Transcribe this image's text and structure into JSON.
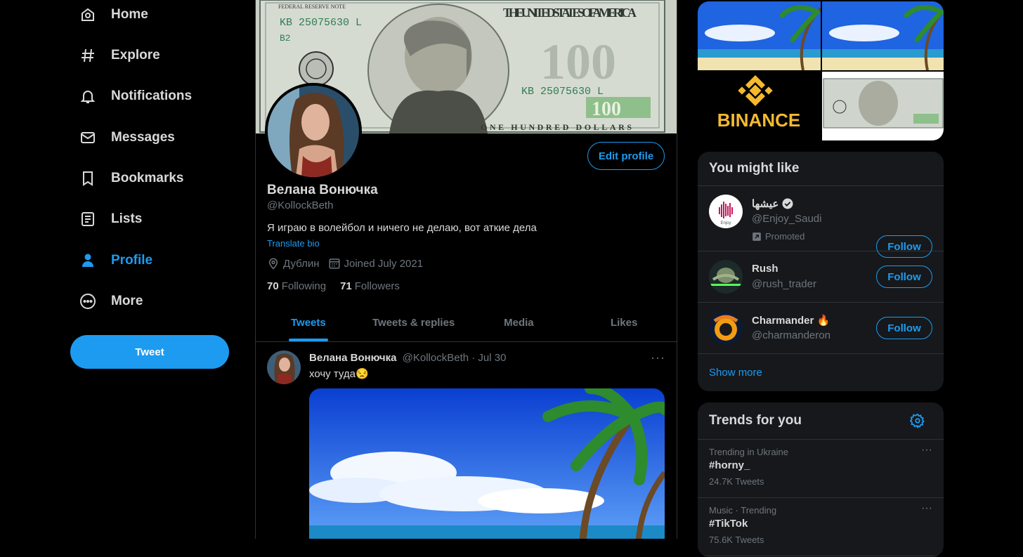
{
  "nav": {
    "items": [
      {
        "label": "Home",
        "icon": "home-icon"
      },
      {
        "label": "Explore",
        "icon": "hashtag-icon"
      },
      {
        "label": "Notifications",
        "icon": "bell-icon"
      },
      {
        "label": "Messages",
        "icon": "envelope-icon"
      },
      {
        "label": "Bookmarks",
        "icon": "bookmark-icon"
      },
      {
        "label": "Lists",
        "icon": "list-icon"
      },
      {
        "label": "Profile",
        "icon": "person-icon",
        "active": true
      },
      {
        "label": "More",
        "icon": "more-circle-icon"
      }
    ],
    "tweet_button": "Tweet"
  },
  "profile": {
    "name": "Велана Вонючка",
    "handle": "@KollockBeth",
    "bio": "Я играю в волейбол и ничего не делаю, вот аткие дела",
    "translate": "Translate bio",
    "location": "Дублин",
    "joined": "Joined July 2021",
    "following_count": "70",
    "following_label": "Following",
    "followers_count": "71",
    "followers_label": "Followers",
    "edit_button": "Edit profile",
    "banner": {
      "text_top": "FEDERAL RESERVE NOTE",
      "serial_1": "KB 25075630 L",
      "serial_2": "B2",
      "usa": "THE UNITED STATES OF AMERICA",
      "number": "100",
      "serial_3": "KB 25075630 L",
      "bottom": "ONE HUNDRED DOLLARS"
    }
  },
  "tabs": [
    {
      "label": "Tweets",
      "active": true
    },
    {
      "label": "Tweets & replies"
    },
    {
      "label": "Media"
    },
    {
      "label": "Likes"
    }
  ],
  "tweet": {
    "name": "Велана Вонючка",
    "handle": "@KollockBeth",
    "time": "· Jul 30",
    "text": "хочу туда😒",
    "more": "···"
  },
  "media_grid": {
    "binance_label": "BINANCE"
  },
  "you_might_like": {
    "title": "You might like",
    "accounts": [
      {
        "name": "عيشها",
        "handle": "@Enjoy_Saudi",
        "verified": true,
        "promoted": "Promoted",
        "button": "Follow"
      },
      {
        "name": "Rush",
        "handle": "@rush_trader",
        "button": "Follow"
      },
      {
        "name": "Charmander 🔥",
        "handle": "@charmanderon",
        "button": "Follow"
      }
    ],
    "show_more": "Show more"
  },
  "trends": {
    "title": "Trends for you",
    "items": [
      {
        "context": "Trending in Ukraine",
        "title": "#horny_",
        "count": "24.7K Tweets"
      },
      {
        "context": "Music · Trending",
        "title": "#TikTok",
        "count": "75.6K Tweets"
      }
    ]
  },
  "colors": {
    "accent": "#1d9bf0",
    "background": "#000000",
    "card": "#16181c",
    "muted": "#6e767d",
    "text": "#d9d9d9"
  }
}
